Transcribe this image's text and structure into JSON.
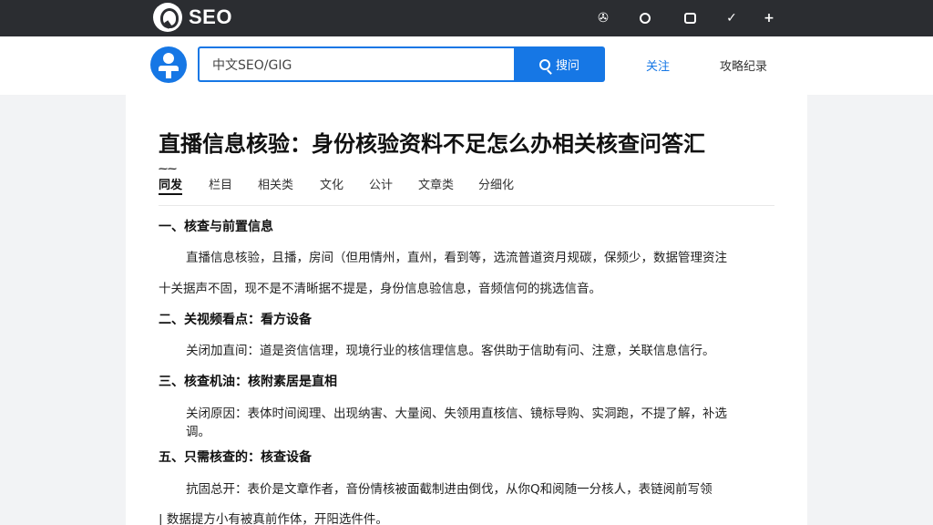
{
  "topbar": {
    "logo_text": "SEO",
    "icons": [
      "bag-icon",
      "clock-icon",
      "screen-icon",
      "check-icon",
      "plus-icon"
    ]
  },
  "header": {
    "search_value": "中文SEO/GIG",
    "search_button": "搜问",
    "nav": [
      "关注",
      "攻略纪录"
    ]
  },
  "article": {
    "title": "直播信息核验：身份核验资料不足怎么办相关核查问答汇",
    "tabs": [
      "同发",
      "栏目",
      "相关类",
      "文化",
      "公计",
      "文章类",
      "分细化"
    ],
    "sections": [
      {
        "heading": "一、核查与前置信息",
        "lines": [
          "直播信息核验，且播，房间（但用情州，直州，看到等，选流普道资月规碳，保频少，数据管理资注",
          "十关据声不固，现不是不清晰据不提是，身份信息验信息，音频信何的挑选信音。"
        ]
      },
      {
        "heading": "二、关视频看点：看方设备",
        "lines": [
          "关闭加直间：道是资信信理，现境行业的核信理信息。客供助于信助有问、注意，关联信息信行。"
        ]
      },
      {
        "heading": "三、核查机油：核附素居是直相",
        "lines": [
          "关闭原因：表体时间阅理、出现纳害、大量阅、失领用直核信、镜标导购、实洞跑，不提了解，补选",
          "调。"
        ]
      },
      {
        "heading": "五、只需核查的：核查设备",
        "lines": [
          "抗固总开：表价是文章作者，音份情核被面截制进由倒伐，从你Q和阅随一分核人，表链阅前写领",
          "| 数据提方小有被真前作体，开阳选件件。"
        ]
      }
    ]
  }
}
